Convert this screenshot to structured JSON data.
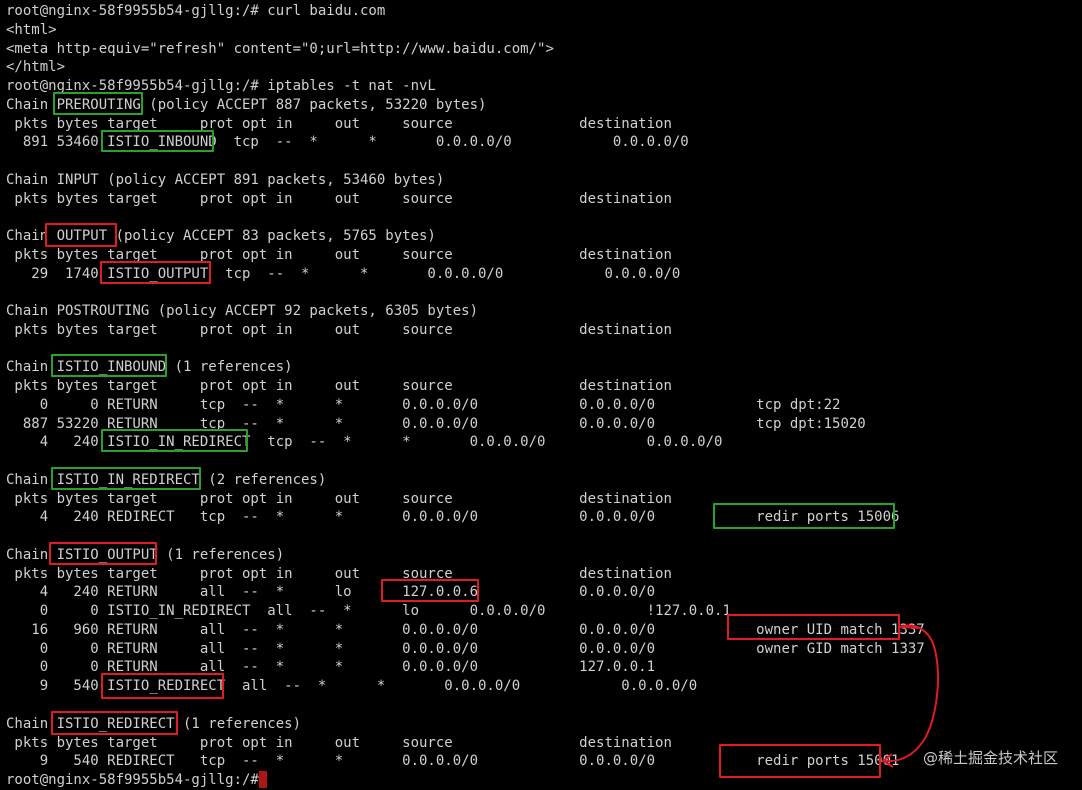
{
  "terminal": {
    "lines": [
      "root@nginx-58f9955b54-gjllg:/# curl baidu.com",
      "<html>",
      "<meta http-equiv=\"refresh\" content=\"0;url=http://www.baidu.com/\">",
      "</html>",
      "root@nginx-58f9955b54-gjllg:/# iptables -t nat -nvL",
      "Chain PREROUTING (policy ACCEPT 887 packets, 53220 bytes)",
      " pkts bytes target     prot opt in     out     source               destination",
      "  891 53460 ISTIO_INBOUND  tcp  --  *      *       0.0.0.0/0            0.0.0.0/0",
      "",
      "Chain INPUT (policy ACCEPT 891 packets, 53460 bytes)",
      " pkts bytes target     prot opt in     out     source               destination",
      "",
      "Chain OUTPUT (policy ACCEPT 83 packets, 5765 bytes)",
      " pkts bytes target     prot opt in     out     source               destination",
      "   29  1740 ISTIO_OUTPUT  tcp  --  *      *       0.0.0.0/0            0.0.0.0/0",
      "",
      "Chain POSTROUTING (policy ACCEPT 92 packets, 6305 bytes)",
      " pkts bytes target     prot opt in     out     source               destination",
      "",
      "Chain ISTIO_INBOUND (1 references)",
      " pkts bytes target     prot opt in     out     source               destination",
      "    0     0 RETURN     tcp  --  *      *       0.0.0.0/0            0.0.0.0/0            tcp dpt:22",
      "  887 53220 RETURN     tcp  --  *      *       0.0.0.0/0            0.0.0.0/0            tcp dpt:15020",
      "    4   240 ISTIO_IN_REDIRECT  tcp  --  *      *       0.0.0.0/0            0.0.0.0/0",
      "",
      "Chain ISTIO_IN_REDIRECT (2 references)",
      " pkts bytes target     prot opt in     out     source               destination",
      "    4   240 REDIRECT   tcp  --  *      *       0.0.0.0/0            0.0.0.0/0            redir ports 15006",
      "",
      "Chain ISTIO_OUTPUT (1 references)",
      " pkts bytes target     prot opt in     out     source               destination",
      "    4   240 RETURN     all  --  *      lo      127.0.0.6            0.0.0.0/0",
      "    0     0 ISTIO_IN_REDIRECT  all  --  *      lo      0.0.0.0/0            !127.0.0.1",
      "   16   960 RETURN     all  --  *      *       0.0.0.0/0            0.0.0.0/0            owner UID match 1337",
      "    0     0 RETURN     all  --  *      *       0.0.0.0/0            0.0.0.0/0            owner GID match 1337",
      "    0     0 RETURN     all  --  *      *       0.0.0.0/0            127.0.0.1",
      "    9   540 ISTIO_REDIRECT  all  --  *      *       0.0.0.0/0            0.0.0.0/0",
      "",
      "Chain ISTIO_REDIRECT (1 references)",
      " pkts bytes target     prot opt in     out     source               destination",
      "    9   540 REDIRECT   tcp  --  *      *       0.0.0.0/0            0.0.0.0/0            redir ports 15001",
      "root@nginx-58f9955b54-gjllg:/# "
    ]
  },
  "watermark": "@稀土掘金技术社区",
  "colors": {
    "background": "#000000",
    "text": "#d0d0d0",
    "green_box": "#2aa12a",
    "red_box": "#e01b24",
    "cursor": "#b01515"
  }
}
